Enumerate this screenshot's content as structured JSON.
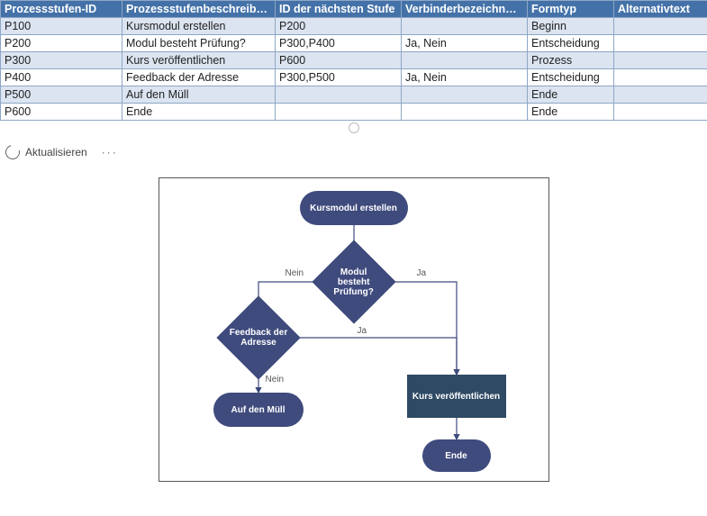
{
  "table": {
    "headers": [
      "Prozessstufen-ID",
      "Prozessstufenbeschreibung",
      "ID der nächsten Stufe",
      "Verbinderbezeichnung",
      "Formtyp",
      "Alternativtext"
    ],
    "rows": [
      {
        "id": "P100",
        "desc": "Kursmodul erstellen",
        "next": "P200",
        "conn": "",
        "shape": "Beginn",
        "alt": ""
      },
      {
        "id": "P200",
        "desc": "Modul besteht Prüfung?",
        "next": "P300,P400",
        "conn": "Ja, Nein",
        "shape": "Entscheidung",
        "alt": ""
      },
      {
        "id": "P300",
        "desc": "Kurs veröffentlichen",
        "next": "P600",
        "conn": "",
        "shape": "Prozess",
        "alt": ""
      },
      {
        "id": "P400",
        "desc": "Feedback der Adresse",
        "next": "P300,P500",
        "conn": "Ja, Nein",
        "shape": "Entscheidung",
        "alt": ""
      },
      {
        "id": "P500",
        "desc": "Auf den Müll",
        "next": "",
        "conn": "",
        "shape": "Ende",
        "alt": ""
      },
      {
        "id": "P600",
        "desc": "Ende",
        "next": "",
        "conn": "",
        "shape": "Ende",
        "alt": ""
      }
    ]
  },
  "toolbar": {
    "refresh": "Aktualisieren",
    "more": "···"
  },
  "flow": {
    "n_start": "Kursmodul erstellen",
    "n_q1": "Modul besteht Prüfung?",
    "n_q2": "Feedback der Adresse",
    "n_trash": "Auf den Müll",
    "n_proc": "Kurs veröffentlichen",
    "n_end": "Ende",
    "yes": "Ja",
    "no": "Nein"
  },
  "chart_data": {
    "type": "flowchart",
    "title": "",
    "nodes": [
      {
        "id": "P100",
        "label": "Kursmodul erstellen",
        "shape": "terminator-start"
      },
      {
        "id": "P200",
        "label": "Modul besteht Prüfung?",
        "shape": "decision"
      },
      {
        "id": "P300",
        "label": "Kurs veröffentlichen",
        "shape": "process"
      },
      {
        "id": "P400",
        "label": "Feedback der Adresse",
        "shape": "decision"
      },
      {
        "id": "P500",
        "label": "Auf den Müll",
        "shape": "terminator-end"
      },
      {
        "id": "P600",
        "label": "Ende",
        "shape": "terminator-end"
      }
    ],
    "edges": [
      {
        "from": "P100",
        "to": "P200",
        "label": ""
      },
      {
        "from": "P200",
        "to": "P300",
        "label": "Ja"
      },
      {
        "from": "P200",
        "to": "P400",
        "label": "Nein"
      },
      {
        "from": "P400",
        "to": "P300",
        "label": "Ja"
      },
      {
        "from": "P400",
        "to": "P500",
        "label": "Nein"
      },
      {
        "from": "P300",
        "to": "P600",
        "label": ""
      }
    ]
  }
}
